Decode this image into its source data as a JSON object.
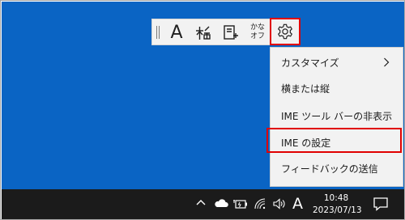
{
  "ime_toolbar": {
    "mode_label": "A",
    "kana_line1": "かな",
    "kana_line2": "オフ"
  },
  "context_menu": {
    "items": [
      {
        "label": "カスタマイズ",
        "has_submenu": true
      },
      {
        "label": "横または縦"
      },
      {
        "label": "IME ツール バーの非表示"
      },
      {
        "label": "IME の設定"
      },
      {
        "label": "フィードバックの送信"
      }
    ]
  },
  "taskbar": {
    "ime_indicator": "A",
    "time": "10:48",
    "date": "2023/07/13"
  },
  "colors": {
    "desktop": "#0a64c4",
    "highlight_border": "#e00000",
    "taskbar": "#1b1b1b",
    "menu_background": "#f2f2f2"
  }
}
